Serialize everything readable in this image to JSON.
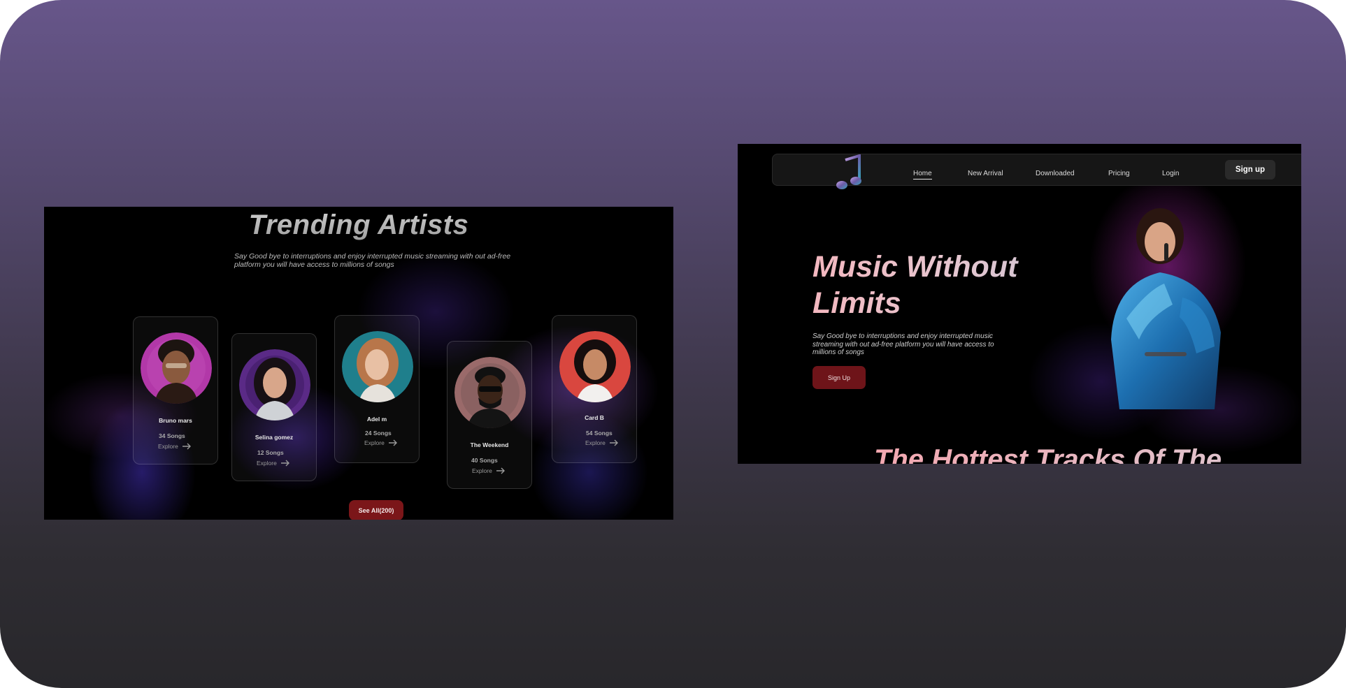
{
  "trending": {
    "title": "Trending Artists",
    "subtitle": "Say Good bye to interruptions  and enjoy interrupted music streaming with out ad-free platform you will have access to millions of songs",
    "artists": [
      {
        "name": "Bruno mars",
        "songs": "34 Songs",
        "explore": "Explore",
        "photo_bg": "#b238a8"
      },
      {
        "name": "Selina gomez",
        "songs": "12 Songs",
        "explore": "Explore",
        "photo_bg": "#5a2a86"
      },
      {
        "name": "Adel m",
        "songs": "24 Songs",
        "explore": "Explore",
        "photo_bg": "#1f7f8c"
      },
      {
        "name": "The Weekend",
        "songs": "40 Songs",
        "explore": "Explore",
        "photo_bg": "#9a6a6a"
      },
      {
        "name": "Card B",
        "songs": "54 Songs",
        "explore": "Explore",
        "photo_bg": "#d9473f"
      }
    ],
    "see_all": "See All(200)"
  },
  "hero": {
    "nav": {
      "links": [
        "Home",
        "New Arrival",
        "Downloaded",
        "Pricing",
        "Login"
      ],
      "active": "Home",
      "signup": "Sign up"
    },
    "title": "Music Without Limits",
    "subtitle": "Say Good bye to interruptions  and enjoy interrupted music streaming with out ad-free  platform you will have access to millions of songs",
    "cta": "Sign Up",
    "next_section_heading": "The Hottest Tracks  Of The"
  },
  "colors": {
    "accent_red": "#7b1619",
    "background_top": "#67568a",
    "background_bottom": "#28272b"
  }
}
